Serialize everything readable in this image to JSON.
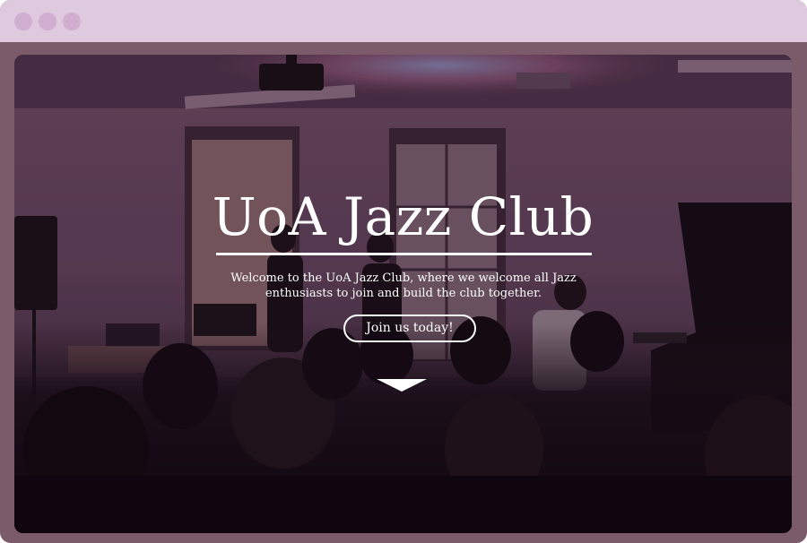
{
  "window": {
    "controls": [
      "close-dot",
      "minimize-dot",
      "maximize-dot"
    ]
  },
  "hero": {
    "title": "UoA Jazz Club",
    "tagline": "Welcome to the UoA Jazz Club, where we welcome all Jazz enthusiasts to join and build the club together.",
    "cta_label": "Join us today!",
    "scroll_icon": "chevron-down-icon"
  },
  "colors": {
    "titlebar": "#dfc9df",
    "frame": "#7b5a69",
    "text": "#ffffff"
  }
}
